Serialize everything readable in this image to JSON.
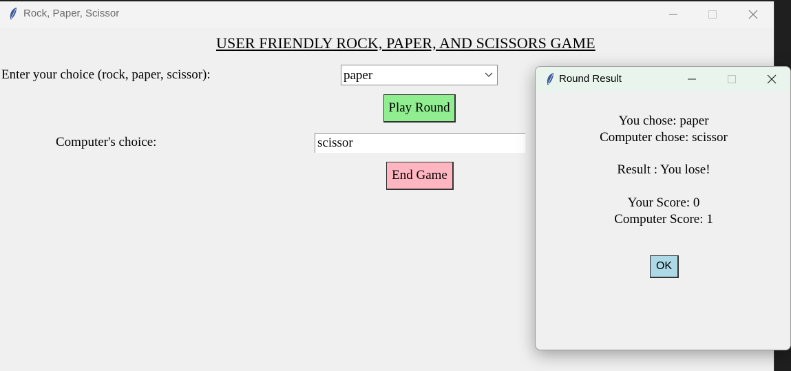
{
  "main_window": {
    "title": "Rock, Paper, Scissor",
    "icon": "feather-icon",
    "heading": "USER FRIENDLY ROCK, PAPER, AND SCISSORS GAME",
    "choice_label": "Enter your choice (rock, paper, scissor):",
    "choice_value": "paper",
    "play_button": "Play Round",
    "computer_label": "Computer's choice:",
    "computer_value": "scissor",
    "end_button": "End Game"
  },
  "dialog": {
    "title": "Round Result",
    "icon": "feather-icon",
    "you_chose": "You chose: paper",
    "computer_chose": "Computer chose: scissor",
    "result": "Result : You lose!",
    "your_score": "Your Score: 0",
    "computer_score": "Computer Score: 1",
    "ok_button": "OK"
  },
  "colors": {
    "play_button_bg": "#90ee90",
    "end_button_bg": "#ffb6c1",
    "ok_button_bg": "#add8e6",
    "window_bg": "#f0f0f0"
  }
}
